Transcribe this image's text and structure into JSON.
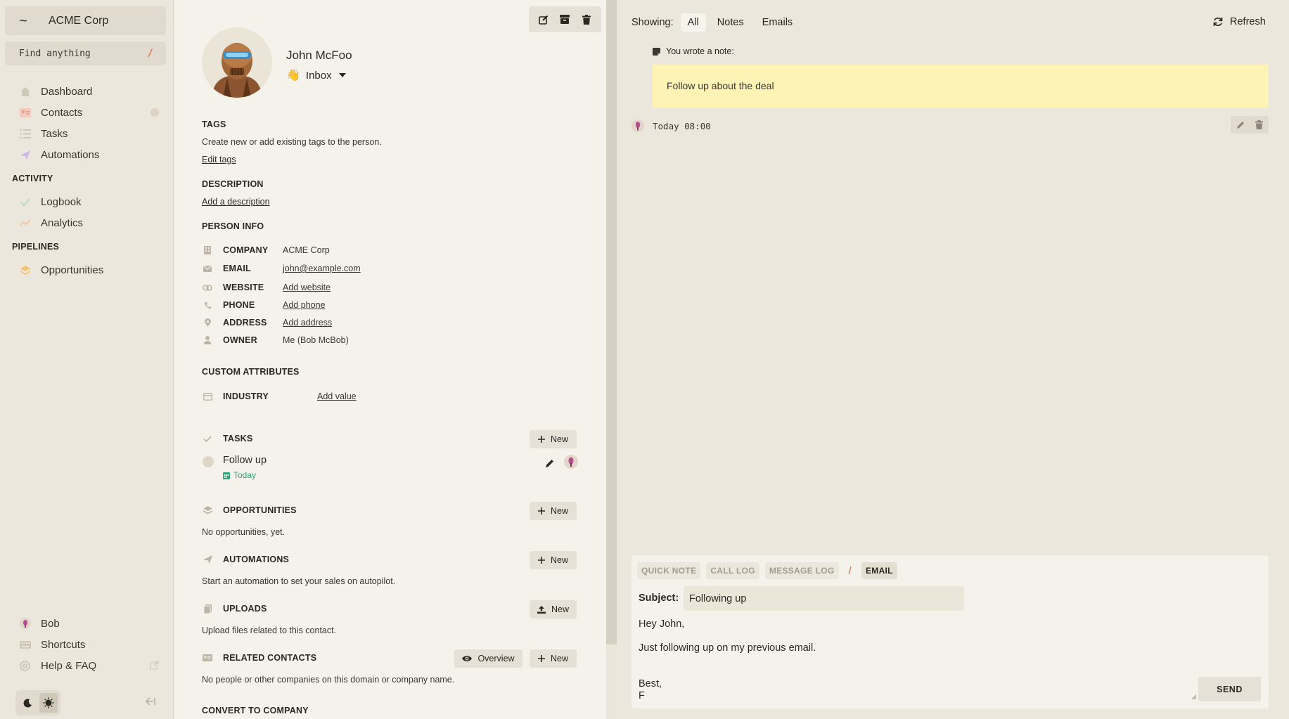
{
  "sidebar": {
    "org_name": "ACME Corp",
    "org_icon": "~",
    "search": {
      "placeholder": "Find anything",
      "shortcut": "/"
    },
    "nav": [
      {
        "label": "Dashboard",
        "icon": "home-icon"
      },
      {
        "label": "Contacts",
        "icon": "contacts-icon"
      },
      {
        "label": "Tasks",
        "icon": "tasks-icon"
      },
      {
        "label": "Automations",
        "icon": "automations-icon"
      }
    ],
    "activity_heading": "ACTIVITY",
    "activity": [
      {
        "label": "Logbook",
        "icon": "check-icon"
      },
      {
        "label": "Analytics",
        "icon": "analytics-icon"
      }
    ],
    "pipelines_heading": "PIPELINES",
    "pipelines": [
      {
        "label": "Opportunities",
        "icon": "layers-icon"
      }
    ],
    "footer": [
      {
        "label": "Bob",
        "icon": "user-avatar-icon"
      },
      {
        "label": "Shortcuts",
        "icon": "keyboard-icon"
      },
      {
        "label": "Help & FAQ",
        "icon": "help-icon"
      }
    ]
  },
  "person": {
    "name": "John McFoo",
    "inbox_label": "Inbox",
    "inbox_emoji": "👋",
    "tags": {
      "heading": "TAGS",
      "text": "Create new or add existing tags to the person.",
      "link": "Edit tags"
    },
    "description": {
      "heading": "DESCRIPTION",
      "link": "Add a description"
    },
    "info": {
      "heading": "PERSON INFO",
      "rows": [
        {
          "label": "COMPANY",
          "value": "ACME Corp",
          "icon": "building-icon"
        },
        {
          "label": "EMAIL",
          "value": "john@example.com",
          "icon": "mail-icon"
        },
        {
          "label": "WEBSITE",
          "value": "Add website",
          "icon": "link-icon"
        },
        {
          "label": "PHONE",
          "value": "Add phone",
          "icon": "phone-icon"
        },
        {
          "label": "ADDRESS",
          "value": "Add address",
          "icon": "pin-icon"
        },
        {
          "label": "OWNER",
          "value": "Me (Bob McBob)",
          "icon": "user-icon"
        }
      ]
    },
    "custom": {
      "heading": "CUSTOM ATTRIBUTES",
      "rows": [
        {
          "label": "INDUSTRY",
          "value": "Add value",
          "icon": "table-icon"
        }
      ]
    },
    "tasks": {
      "heading": "TASKS",
      "new_label": "New",
      "items": [
        {
          "title": "Follow up",
          "due": "Today"
        }
      ]
    },
    "opportunities": {
      "heading": "OPPORTUNITIES",
      "new_label": "New",
      "empty": "No opportunities, yet."
    },
    "automations": {
      "heading": "AUTOMATIONS",
      "new_label": "New",
      "empty": "Start an automation to set your sales on autopilot."
    },
    "uploads": {
      "heading": "UPLOADS",
      "new_label": "New",
      "empty": "Upload files related to this contact."
    },
    "related": {
      "heading": "RELATED CONTACTS",
      "overview_label": "Overview",
      "new_label": "New",
      "empty": "No people or other companies on this domain or company name."
    },
    "convert": {
      "heading": "CONVERT TO COMPANY"
    }
  },
  "timeline": {
    "showing_label": "Showing:",
    "filters": [
      "All",
      "Notes",
      "Emails"
    ],
    "active_filter": "All",
    "refresh_label": "Refresh",
    "note": {
      "header": "You wrote a note:",
      "body": "Follow up about the deal",
      "time": "Today 08:00"
    }
  },
  "composer": {
    "tabs": [
      "QUICK NOTE",
      "CALL LOG",
      "MESSAGE LOG"
    ],
    "active_tab": "EMAIL",
    "subject_label": "Subject:",
    "subject_value": "Following up",
    "body": "Hey John,\n\nJust following up on my previous email.\n\n\nBest,\nF",
    "send_label": "SEND"
  },
  "colors": {
    "accent_slash": "#e0613a",
    "note_bg": "#fdf3b5",
    "due_green": "#2fa37a",
    "sidebar_bg": "#ece7dc",
    "panel_bg": "#f5f2eb"
  }
}
